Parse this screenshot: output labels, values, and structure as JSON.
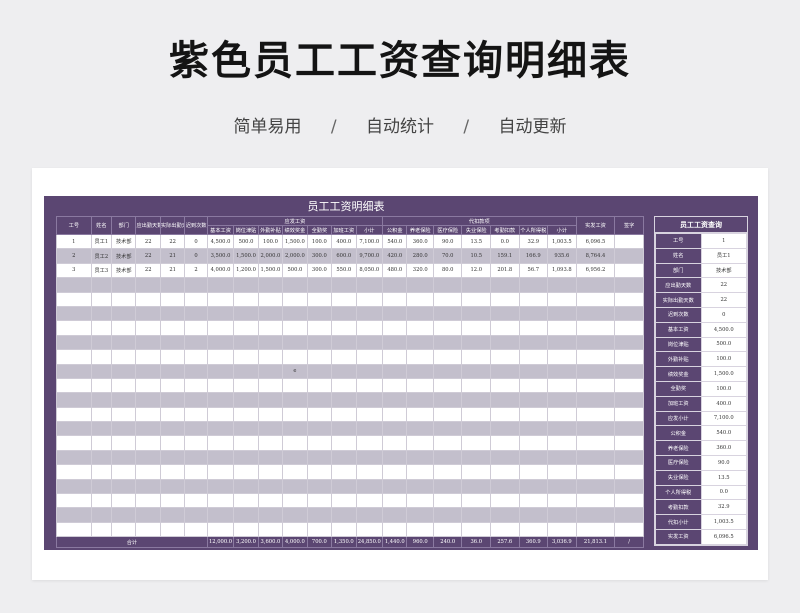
{
  "title": "紫色员工工资查询明细表",
  "subtitle": [
    "简单易用",
    "自动统计",
    "自动更新"
  ],
  "separator": "/",
  "sheet_title": "员工工资明细表",
  "headers": {
    "id": "工号",
    "name": "姓名",
    "dept": "部门",
    "should_days": "应出勤天数",
    "actual_days": "实际出勤天数",
    "late": "迟到次数",
    "pay_group": "应发工资",
    "pay_cols": [
      "基本工资",
      "岗位津贴",
      "外勤补贴",
      "绩效奖金",
      "全勤奖",
      "加班工资",
      "小计"
    ],
    "deduct_group": "代扣款项",
    "deduct_cols": [
      "公积金",
      "养老保险",
      "医疗保险",
      "失业保险",
      "考勤扣款",
      "个人所得税",
      "小计"
    ],
    "net": "实发工资",
    "sign": "签字"
  },
  "rows": [
    [
      "1",
      "员工1",
      "技术部",
      "22",
      "22",
      "0",
      "4,500.0",
      "500.0",
      "100.0",
      "1,500.0",
      "100.0",
      "400.0",
      "7,100.0",
      "540.0",
      "360.0",
      "90.0",
      "13.5",
      "0.0",
      "32.9",
      "1,003.5",
      "6,096.5",
      ""
    ],
    [
      "2",
      "员工2",
      "技术部",
      "22",
      "21",
      "0",
      "3,500.0",
      "1,500.0",
      "2,000.0",
      "2,000.0",
      "300.0",
      "600.0",
      "9,700.0",
      "420.0",
      "280.0",
      "70.0",
      "10.5",
      "159.1",
      "166.9",
      "935.6",
      "8,764.4",
      ""
    ],
    [
      "3",
      "员工3",
      "技术部",
      "22",
      "21",
      "2",
      "4,000.0",
      "1,200.0",
      "1,500.0",
      "500.0",
      "300.0",
      "550.0",
      "8,050.0",
      "480.0",
      "320.0",
      "80.0",
      "12.0",
      "201.8",
      "56.7",
      "1,093.8",
      "6,956.2",
      ""
    ]
  ],
  "stray_mark": "e",
  "totals": {
    "label": "合计",
    "values": [
      "12,000.0",
      "3,200.0",
      "3,600.0",
      "4,000.0",
      "700.0",
      "1,350.0",
      "24,850.0",
      "1,440.0",
      "960.0",
      "240.0",
      "36.0",
      "257.6",
      "360.9",
      "3,036.9",
      "21,813.1",
      "/"
    ]
  },
  "query": {
    "title": "员工工资查询",
    "rows": [
      {
        "k": "工号",
        "v": "1"
      },
      {
        "k": "姓名",
        "v": "员工1"
      },
      {
        "k": "部门",
        "v": "技术部"
      },
      {
        "k": "应出勤天数",
        "v": "22"
      },
      {
        "k": "实际出勤天数",
        "v": "22"
      },
      {
        "k": "迟到次数",
        "v": "0"
      },
      {
        "k": "基本工资",
        "v": "4,500.0"
      },
      {
        "k": "岗位津贴",
        "v": "500.0"
      },
      {
        "k": "外勤补贴",
        "v": "100.0"
      },
      {
        "k": "绩效奖金",
        "v": "1,500.0"
      },
      {
        "k": "全勤奖",
        "v": "100.0"
      },
      {
        "k": "加班工资",
        "v": "400.0"
      },
      {
        "k": "应发小计",
        "v": "7,100.0"
      },
      {
        "k": "公积金",
        "v": "540.0"
      },
      {
        "k": "养老保险",
        "v": "360.0"
      },
      {
        "k": "医疗保险",
        "v": "90.0"
      },
      {
        "k": "失业保险",
        "v": "13.5"
      },
      {
        "k": "个人所得税",
        "v": "0.0"
      },
      {
        "k": "考勤扣款",
        "v": "32.9"
      },
      {
        "k": "代扣小计",
        "v": "1,003.5"
      },
      {
        "k": "实发工资",
        "v": "6,096.5"
      }
    ]
  }
}
